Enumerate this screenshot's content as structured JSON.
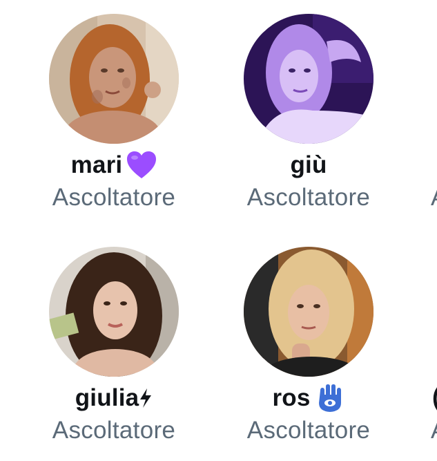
{
  "speakers": [
    {
      "name": "mari",
      "role": "Ascoltatore",
      "badge": "purple-heart"
    },
    {
      "name": "giù",
      "role": "Ascoltatore",
      "badge": ""
    },
    {
      "name": "giulia",
      "role": "Ascoltatore",
      "badge": "lightning"
    },
    {
      "name": "ros",
      "role": "Ascoltatore",
      "badge": "hamsa-hand"
    }
  ],
  "partial_column": {
    "row1_role_fragment": "A",
    "row2_name_fragment": "(",
    "row2_role_fragment": "A"
  },
  "colors": {
    "name_text": "#111418",
    "role_text": "#5b6a78",
    "heart": "#9b4dff",
    "hamsa": "#3d6fd6"
  }
}
